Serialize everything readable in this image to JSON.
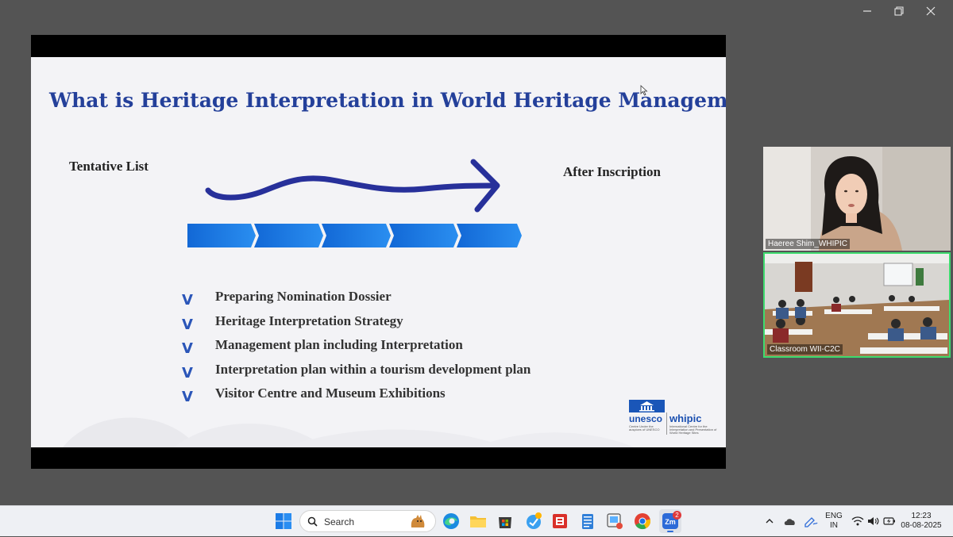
{
  "slide": {
    "title": "What is Heritage Interpretation in World Heritage Management",
    "left_label": "Tentative List",
    "right_label": "After Inscription",
    "checklist": [
      "Preparing Nomination Dossier",
      "Heritage Interpretation Strategy",
      "Management plan including Interpretation",
      "Interpretation plan within a tourism development plan",
      "Visitor Centre and Museum Exhibitions"
    ],
    "check_glyph": "V",
    "logo": {
      "unesco": "unesco",
      "unesco_sub": "Centre Under the auspices of UNESCO",
      "whipic": "whipic",
      "whipic_sub": "International Centre for the Interpretation and Presentation of World Heritage Sites"
    },
    "colors": {
      "title": "#24409a",
      "chevron": "#1a78e0",
      "arrow": "#27309a"
    }
  },
  "participants": [
    {
      "name": "Haeree Shim_WHIPIC",
      "active_speaker": false
    },
    {
      "name": "Classroom WII-C2C",
      "active_speaker": true
    }
  ],
  "taskbar": {
    "search_placeholder": "Search",
    "zoom_badge": "2",
    "language": "ENG",
    "region": "IN",
    "time": "12:23",
    "date": "08-08-2025"
  }
}
